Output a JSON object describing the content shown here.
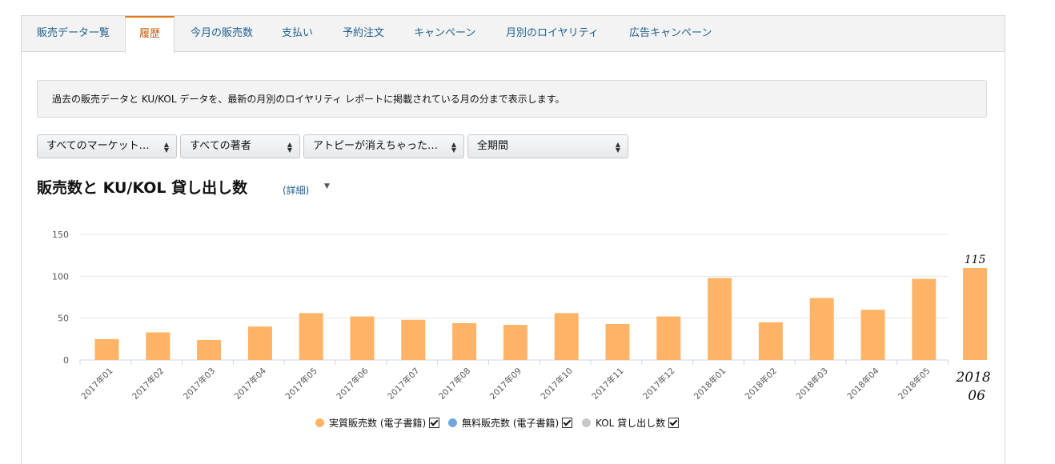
{
  "tabs": [
    {
      "label": "販売データ一覧",
      "active": false
    },
    {
      "label": "履歴",
      "active": true
    },
    {
      "label": "今月の販売数",
      "active": false
    },
    {
      "label": "支払い",
      "active": false
    },
    {
      "label": "予約注文",
      "active": false
    },
    {
      "label": "キャンペーン",
      "active": false
    },
    {
      "label": "月別のロイヤリティ",
      "active": false
    },
    {
      "label": "広告キャンペーン",
      "active": false
    }
  ],
  "info_text": "過去の販売データと KU/KOL データを、最新の月別のロイヤリティ レポートに掲載されている月の分まで表示します。",
  "filters": {
    "marketplace": "すべてのマーケット…",
    "author": "すべての著者",
    "title": "アトピーが消えちゃった…",
    "period": "全期間"
  },
  "section": {
    "title": "販売数と  KU/KOL 貸し出し数",
    "detail_link": "(詳細)"
  },
  "colors": {
    "paid": "#ffb366",
    "free": "#6fa8dc",
    "kol": "#c8c8c8",
    "accent": "#e47911",
    "link": "#1f5f8f"
  },
  "chart_data": {
    "type": "bar",
    "categories": [
      "2017年01",
      "2017年02",
      "2017年03",
      "2017年04",
      "2017年05",
      "2017年06",
      "2017年07",
      "2017年08",
      "2017年09",
      "2017年10",
      "2017年11",
      "2017年12",
      "2018年01",
      "2018年02",
      "2018年03",
      "2018年04",
      "2018年05",
      "2018/06"
    ],
    "series": [
      {
        "name": "実質販売数 (電子書籍)",
        "values": [
          25,
          33,
          24,
          40,
          56,
          52,
          48,
          44,
          42,
          56,
          43,
          52,
          98,
          45,
          74,
          60,
          97,
          110
        ]
      }
    ],
    "yticks": [
      0,
      50,
      100,
      150
    ],
    "ylim": [
      0,
      150
    ],
    "annotations": {
      "handwritten_value": "115",
      "handwritten_label_line1": "2018",
      "handwritten_label_line2": "06"
    }
  },
  "legend": [
    {
      "label": "実質販売数 (電子書籍)",
      "checked": true
    },
    {
      "label": "無料販売数 (電子書籍)",
      "checked": true
    },
    {
      "label": "KOL 貸し出し数",
      "checked": true
    }
  ]
}
